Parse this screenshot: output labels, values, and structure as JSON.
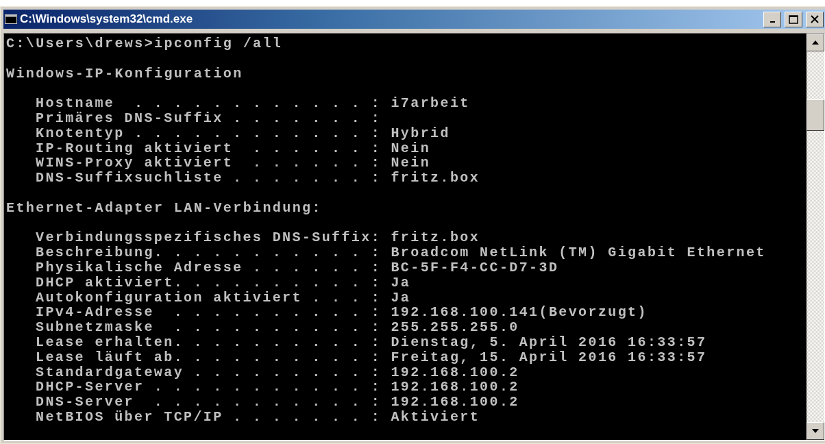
{
  "window": {
    "title": "C:\\Windows\\system32\\cmd.exe"
  },
  "console": {
    "blocks": [
      {
        "kind": "command",
        "lines": [
          "C:\\Users\\drews>ipconfig /all"
        ]
      },
      {
        "kind": "heading",
        "lines": [
          "Windows-IP-Konfiguration"
        ]
      },
      {
        "kind": "entries",
        "lines": [
          "Hostname  . . . . . . . . . . . . : i7arbeit",
          "Primäres DNS-Suffix . . . . . . . :",
          "Knotentyp . . . . . . . . . . . . : Hybrid",
          "IP-Routing aktiviert  . . . . . . : Nein",
          "WINS-Proxy aktiviert  . . . . . . : Nein",
          "DNS-Suffixsuchliste . . . . . . . : fritz.box"
        ]
      },
      {
        "kind": "heading",
        "lines": [
          "Ethernet-Adapter LAN-Verbindung:"
        ]
      },
      {
        "kind": "entries",
        "lines": [
          "Verbindungsspezifisches DNS-Suffix: fritz.box",
          "Beschreibung. . . . . . . . . . . : Broadcom NetLink (TM) Gigabit Ethernet",
          "Physikalische Adresse . . . . . . : BC-5F-F4-CC-D7-3D",
          "DHCP aktiviert. . . . . . . . . . : Ja",
          "Autokonfiguration aktiviert . . . : Ja",
          "IPv4-Adresse  . . . . . . . . . . : 192.168.100.141(Bevorzugt)",
          "Subnetzmaske  . . . . . . . . . . : 255.255.255.0",
          "Lease erhalten. . . . . . . . . . : Dienstag, 5. April 2016 16:33:57",
          "Lease läuft ab. . . . . . . . . . : Freitag, 15. April 2016 16:33:57",
          "Standardgateway . . . . . . . . . : 192.168.100.2",
          "DHCP-Server . . . . . . . . . . . : 192.168.100.2",
          "DNS-Server  . . . . . . . . . . . : 192.168.100.2",
          "NetBIOS über TCP/IP . . . . . . . : Aktiviert"
        ]
      }
    ]
  }
}
